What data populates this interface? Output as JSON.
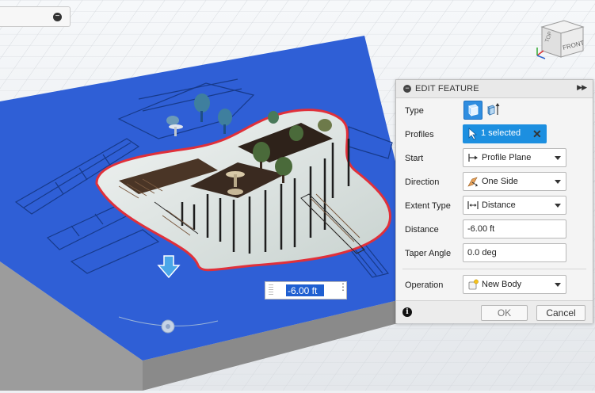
{
  "dimension_input": {
    "value": "-6.00 ft"
  },
  "view_cube": {
    "face_front": "FRONT",
    "face_top": "TOP"
  },
  "panel": {
    "title": "EDIT FEATURE",
    "rows": {
      "type": {
        "label": "Type"
      },
      "profiles": {
        "label": "Profiles",
        "value": "1 selected"
      },
      "start": {
        "label": "Start",
        "value": "Profile Plane"
      },
      "direction": {
        "label": "Direction",
        "value": "One Side"
      },
      "extent_type": {
        "label": "Extent Type",
        "value": "Distance"
      },
      "distance": {
        "label": "Distance",
        "value": "-6.00 ft"
      },
      "taper_angle": {
        "label": "Taper Angle",
        "value": "0.0 deg"
      },
      "operation": {
        "label": "Operation",
        "value": "New Body"
      }
    },
    "ok_label": "OK",
    "cancel_label": "Cancel"
  },
  "colors": {
    "plate_blue": "#2f5fd6",
    "profile_outline": "#e0303a",
    "accent": "#1c8fe0"
  }
}
